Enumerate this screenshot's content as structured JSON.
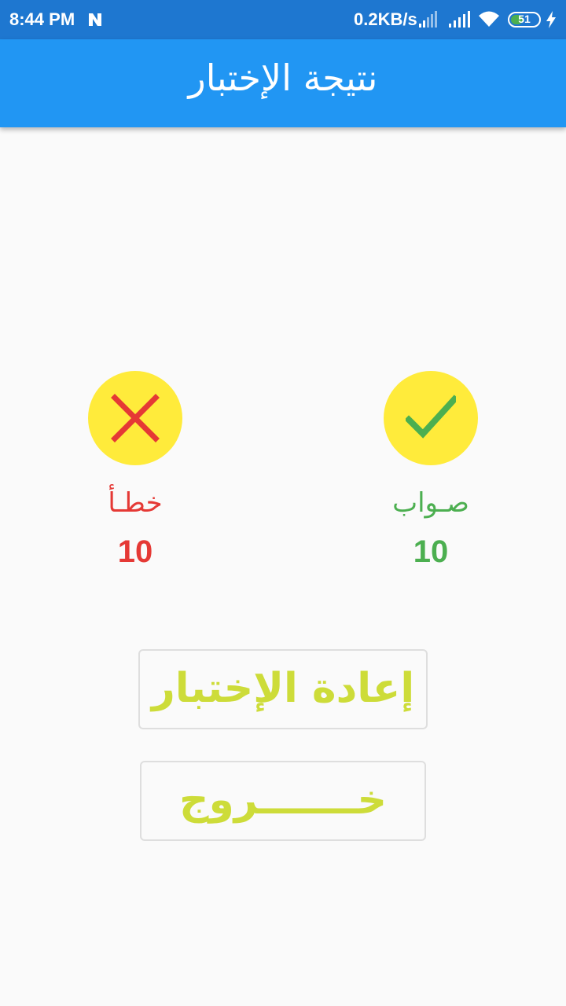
{
  "status_bar": {
    "time": "8:44 PM",
    "network_speed": "0.2KB/s",
    "battery_level": "51",
    "battery_fraction": 0.51,
    "icons": [
      "n-notification-icon",
      "signal-icon",
      "signal-icon",
      "wifi-icon",
      "battery-icon",
      "charging-bolt-icon"
    ]
  },
  "app_bar": {
    "title": "نتيجة الإختبار"
  },
  "results": {
    "wrong": {
      "label": "خطـأ",
      "count": "10",
      "icon": "close-icon",
      "color": "#e53935"
    },
    "right": {
      "label": "صـواب",
      "count": "10",
      "icon": "check-icon",
      "color": "#4caf50"
    }
  },
  "buttons": {
    "retry_label": "إعادة الإختبار",
    "exit_label": "خـــــــروج"
  },
  "colors": {
    "app_bar": "#2196f3",
    "status_bar": "#1e77d0",
    "circle": "#ffeb3b",
    "button_text": "#cddc39",
    "background": "#fafafa"
  }
}
